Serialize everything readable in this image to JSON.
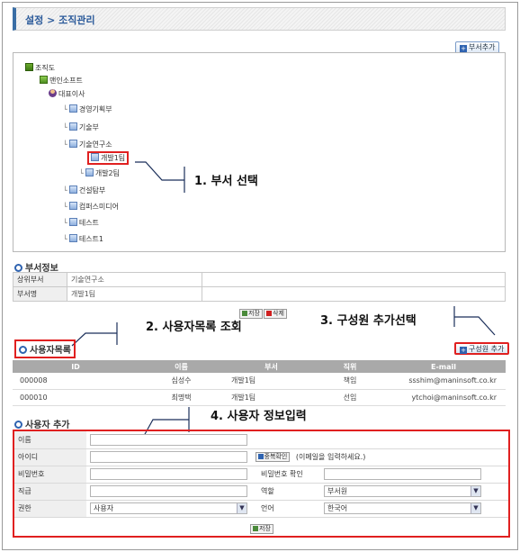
{
  "breadcrumb": {
    "text": "설정 > 조직관리"
  },
  "toolbar": {
    "add_dept_label": "부서추가"
  },
  "tree": {
    "root": "조직도",
    "company": "맨인소프트",
    "ceo": "대표이사",
    "depts": [
      "경영기획부",
      "기술부",
      "기술연구소"
    ],
    "children": [
      "개발1팀",
      "개발2팀"
    ],
    "depts2": [
      "건설탐부",
      "컴퍼스미디어",
      "테스트",
      "테스트1"
    ]
  },
  "annotations": {
    "a1": "1. 부서 선택",
    "a2": "2. 사용자목록 조회",
    "a3": "3. 구성원 추가선택",
    "a4": "4. 사용자 정보입력"
  },
  "dept_info": {
    "title": "부서정보",
    "rows": [
      {
        "label": "상위부서",
        "value": "기술연구소"
      },
      {
        "label": "부서명",
        "value": "개발1팀"
      }
    ],
    "save_label": "저장",
    "delete_label": "삭제"
  },
  "user_list": {
    "title": "사용자목록",
    "add_member_label": "구성원 추가",
    "columns": [
      "ID",
      "이름",
      "부서",
      "직위",
      "E-mail"
    ],
    "rows": [
      [
        "000008",
        "심성수",
        "개발1팀",
        "책임",
        "ssshim@maninsoft.co.kr"
      ],
      [
        "000010",
        "최명택",
        "개발1팀",
        "선임",
        "ytchoi@maninsoft.co.kr"
      ]
    ]
  },
  "user_add": {
    "title": "사용자 추가",
    "name_label": "이름",
    "id_label": "아이디",
    "dup_check_label": "중복확인",
    "id_hint": "(이메일을 입력하세요.)",
    "pw_label": "비밀번호",
    "pw_confirm_label": "비밀번호 확인",
    "rank_label": "직급",
    "role_label": "역할",
    "role_value": "부서원",
    "auth_label": "권한",
    "auth_value": "사용자",
    "lang_label": "언어",
    "lang_value": "한국어",
    "save_label": "저장"
  },
  "colors": {
    "accent": "#2f63b0",
    "highlight": "#e02020"
  }
}
